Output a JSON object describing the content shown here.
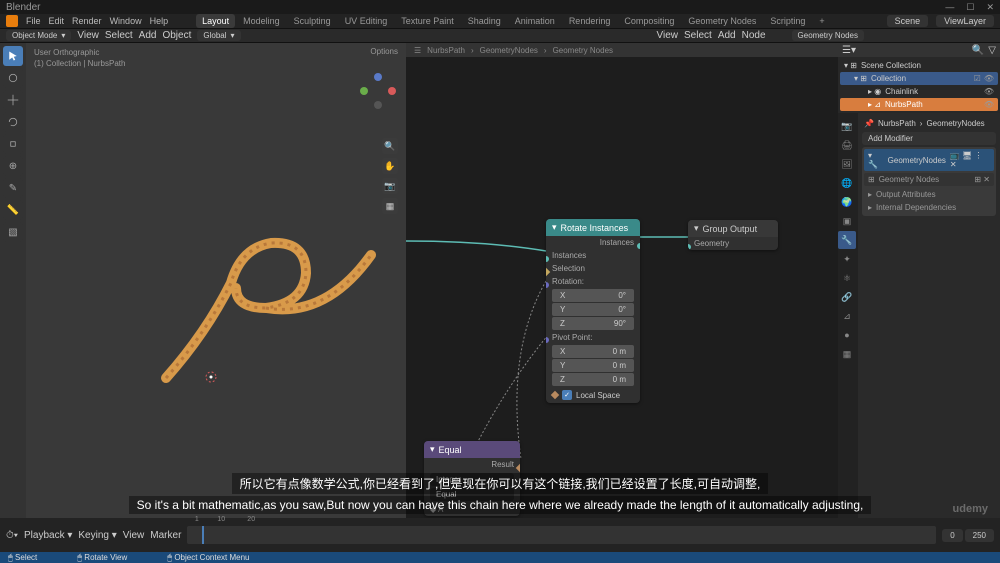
{
  "app": {
    "name": "Blender"
  },
  "menu": [
    "File",
    "Edit",
    "Render",
    "Window",
    "Help"
  ],
  "workspaces": [
    "Layout",
    "Modeling",
    "Sculpting",
    "UV Editing",
    "Texture Paint",
    "Shading",
    "Animation",
    "Rendering",
    "Compositing",
    "Geometry Nodes",
    "Scripting"
  ],
  "scene_box": {
    "scene": "Scene",
    "viewlayer": "ViewLayer"
  },
  "toolbar": {
    "mode": "Object Mode",
    "menu2": [
      "View",
      "Select",
      "Add",
      "Object"
    ],
    "orient": "Global"
  },
  "node_toolbar": {
    "menu": [
      "View",
      "Select",
      "Add",
      "Node"
    ],
    "tree": "Geometry Nodes"
  },
  "viewport": {
    "line1": "User Orthographic",
    "line2": "(1) Collection | NurbsPath",
    "opts": "Options"
  },
  "breadcrumb": [
    "NurbsPath",
    "GeometryNodes",
    "Geometry Nodes"
  ],
  "nodes": {
    "rotate": {
      "title": "Rotate Instances",
      "out": "Instances",
      "inputs": [
        "Instances",
        "Selection"
      ],
      "rotation_label": "Rotation:",
      "rotation": {
        "X": "0°",
        "Y": "0°",
        "Z": "90°"
      },
      "pivot_label": "Pivot Point:",
      "pivot": {
        "X": "0 m",
        "Y": "0 m",
        "Z": "0 m"
      },
      "local": "Local Space"
    },
    "group_out": {
      "title": "Group Output",
      "in": "Geometry"
    },
    "equal": {
      "title": "Equal",
      "result": "Result",
      "type": "Integer",
      "op": "Equal",
      "a": "A"
    }
  },
  "outliner": {
    "root": "Scene Collection",
    "items": [
      {
        "name": "Collection",
        "children": [
          {
            "name": "Chainlink"
          },
          {
            "name": "NurbsPath",
            "hl": true
          }
        ]
      }
    ]
  },
  "properties": {
    "object": "NurbsPath",
    "modifier_tree": "GeometryNodes",
    "add": "Add Modifier",
    "mod": "GeometryNodes",
    "nodename": "Geometry Nodes",
    "sub1": "Output Attributes",
    "sub2": "Internal Dependencies"
  },
  "timeline": {
    "playback": "Playback",
    "keying": "Keying",
    "view": "View",
    "marker": "Marker",
    "frames": [
      "1",
      "10",
      "20"
    ],
    "start": "0",
    "end": "250"
  },
  "status": {
    "a": "Select",
    "b": "Rotate View",
    "c": "Object Context Menu"
  },
  "subtitle": {
    "l1": "所以它有点像数学公式,你已经看到了,但是现在你可以有这个链接,我们已经设置了长度,可自动调整,",
    "l2": "So it's a bit mathematic,as you saw,But now you can have this chain here where we already made the length of it automatically adjusting,"
  },
  "watermark": "udemy"
}
